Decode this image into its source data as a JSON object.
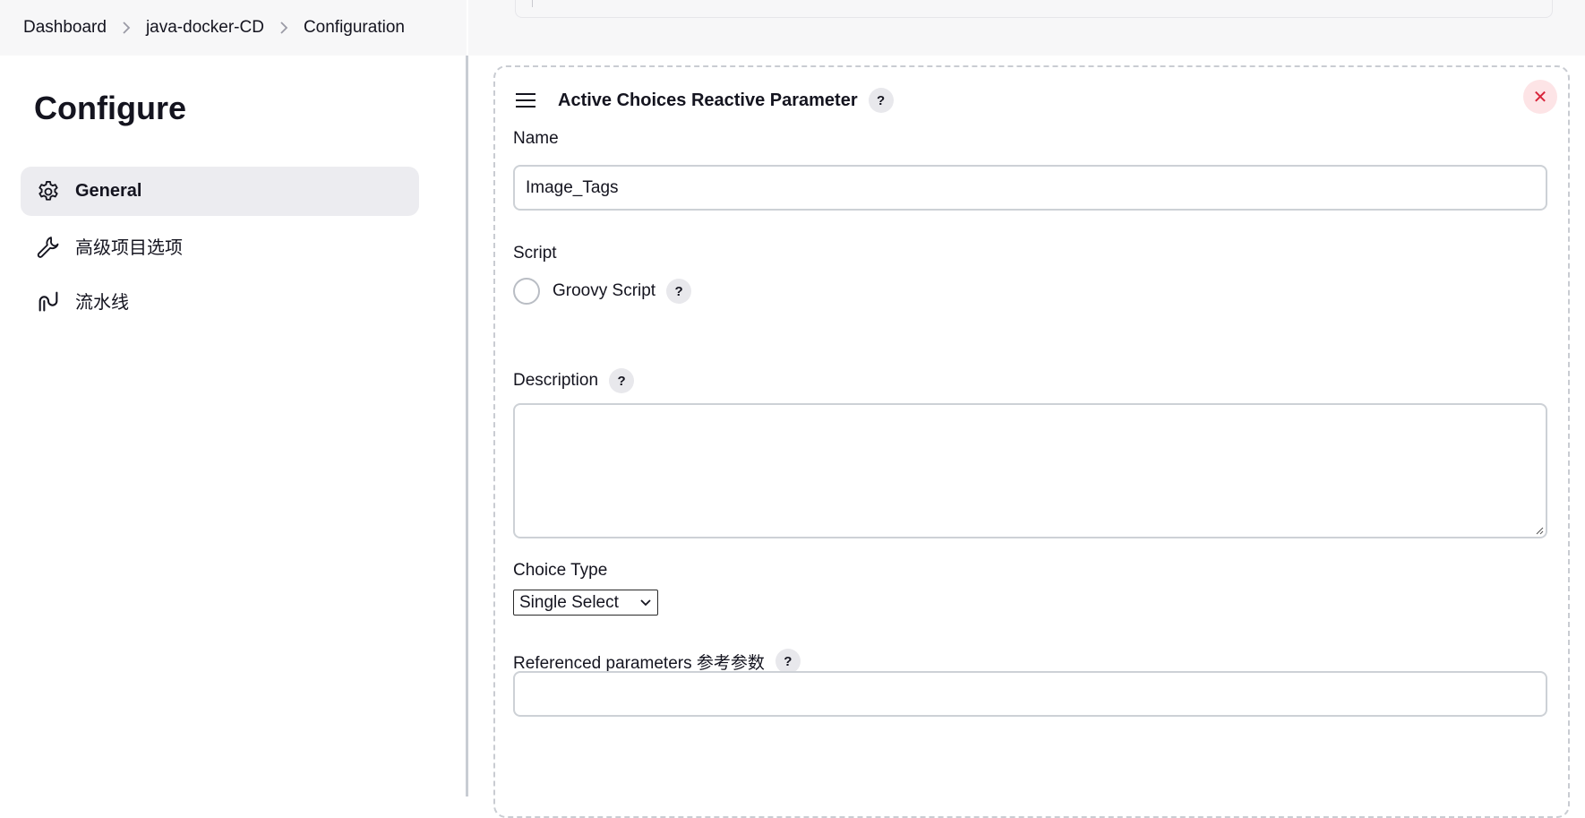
{
  "breadcrumb": {
    "items": [
      "Dashboard",
      "java-docker-CD",
      "Configuration"
    ]
  },
  "sidebar": {
    "title": "Configure",
    "items": [
      {
        "label": "General",
        "icon": "gear-icon",
        "active": true
      },
      {
        "label": "高级项目选项",
        "icon": "wrench-icon",
        "active": false
      },
      {
        "label": "流水线",
        "icon": "pipeline-icon",
        "active": false
      }
    ]
  },
  "parameter": {
    "title": "Active Choices Reactive Parameter",
    "help": "?",
    "close": "✕",
    "name_label": "Name",
    "name_value": "Image_Tags",
    "script_label": "Script",
    "script_option": "Groovy Script",
    "description_label": "Description",
    "description_value": "",
    "choice_type_label": "Choice Type",
    "choice_type_value": "Single Select",
    "referenced_label": "Referenced parameters 参考参数",
    "referenced_value": ""
  },
  "colors": {
    "active_bg": "#ececf0",
    "close_bg": "#fde4e6",
    "close_fg": "#d8243a",
    "border": "#cdd1d6"
  }
}
